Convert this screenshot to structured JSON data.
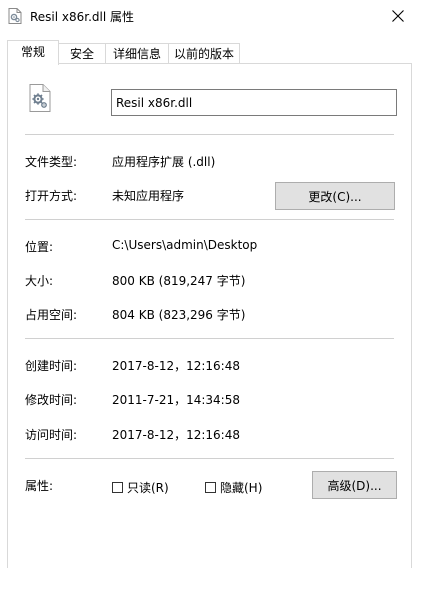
{
  "window": {
    "title": "Resil x86r.dll 属性"
  },
  "tabs": [
    {
      "label": "常规",
      "active": true
    },
    {
      "label": "安全",
      "active": false
    },
    {
      "label": "详细信息",
      "active": false
    },
    {
      "label": "以前的版本",
      "active": false
    }
  ],
  "general": {
    "file_name": "Resil x86r.dll",
    "file_type_label": "文件类型:",
    "file_type_value": "应用程序扩展 (.dll)",
    "opens_with_label": "打开方式:",
    "opens_with_value": "未知应用程序",
    "change_button": "更改(C)...",
    "location_label": "位置:",
    "location_value": "C:\\Users\\admin\\Desktop",
    "size_label": "大小:",
    "size_value": "800 KB (819,247 字节)",
    "size_on_disk_label": "占用空间:",
    "size_on_disk_value": "804 KB (823,296 字节)",
    "created_label": "创建时间:",
    "created_value": "2017-8-12，12:16:48",
    "modified_label": "修改时间:",
    "modified_value": "2011-7-21，14:34:58",
    "accessed_label": "访问时间:",
    "accessed_value": "2017-8-12，12:16:48",
    "attributes_label": "属性:",
    "readonly_label": "只读(R)",
    "hidden_label": "隐藏(H)",
    "advanced_button": "高级(D)..."
  },
  "icons": {
    "title_icon": "dll-file-icon",
    "file_icon": "dll-gear-file-icon",
    "close": "close-icon"
  }
}
